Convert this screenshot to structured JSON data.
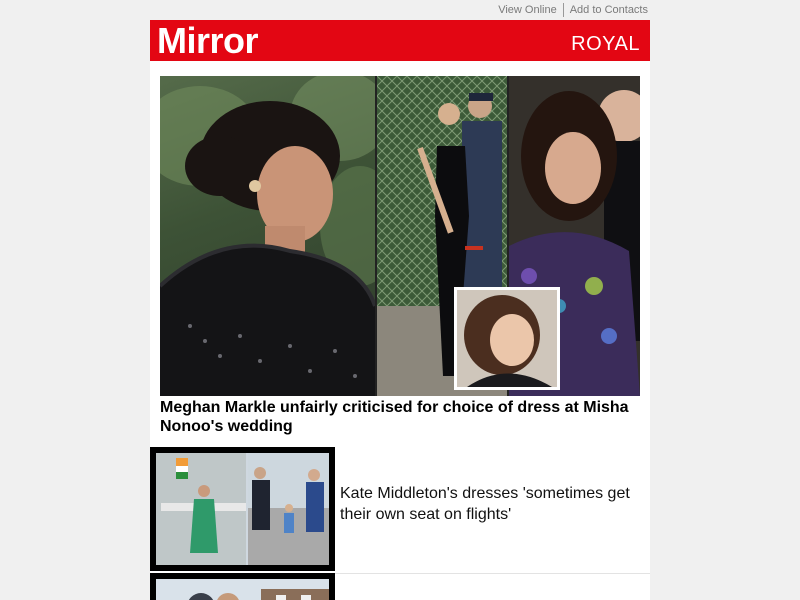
{
  "top_links": {
    "view_online": "View Online",
    "add_to_contacts": "Add to Contacts"
  },
  "masthead": {
    "logo": "Mirror",
    "section": "ROYAL",
    "brand_color": "#e30613"
  },
  "hero": {
    "headline": "Meghan Markle unfairly criticised for choice of dress at Misha Nonoo's wedding"
  },
  "stories": [
    {
      "headline": "Kate Middleton's dresses 'sometimes get their own seat on flights'"
    },
    {
      "headline": ""
    }
  ]
}
